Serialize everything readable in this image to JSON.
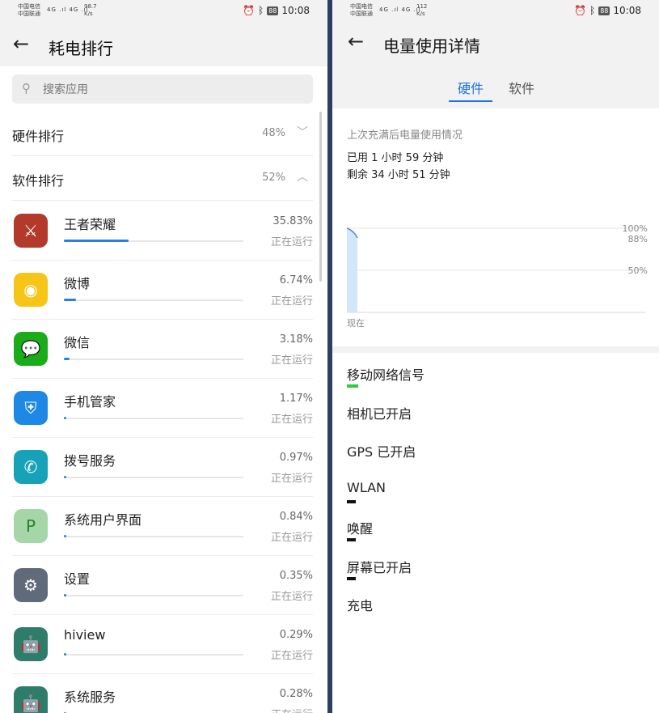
{
  "left": {
    "status": {
      "carrier1": "中国电信",
      "carrier2": "中国联通",
      "signal": "4G .ıl 4G .ıl",
      "speed_value": "98.7",
      "speed_unit": "K/s",
      "battery": "88",
      "time": "10:08"
    },
    "title": "耗电排行",
    "search_placeholder": "搜索应用",
    "sections": [
      {
        "label": "硬件排行",
        "pct": "48%"
      },
      {
        "label": "软件排行",
        "pct": "52%"
      }
    ],
    "apps": [
      {
        "name": "王者荣耀",
        "pct": "35.83%",
        "status": "正在运行",
        "fraction": 0.36,
        "icon": "game-icon",
        "color": "#b33a2a"
      },
      {
        "name": "微博",
        "pct": "6.74%",
        "status": "正在运行",
        "fraction": 0.0674,
        "icon": "weibo-icon",
        "color": "#f5c518"
      },
      {
        "name": "微信",
        "pct": "3.18%",
        "status": "正在运行",
        "fraction": 0.0318,
        "icon": "wechat-icon",
        "color": "#1aad19"
      },
      {
        "name": "手机管家",
        "pct": "1.17%",
        "status": "正在运行",
        "fraction": 0.0117,
        "icon": "shield-icon",
        "color": "#1e88e5"
      },
      {
        "name": "拨号服务",
        "pct": "0.97%",
        "status": "正在运行",
        "fraction": 0.0097,
        "icon": "phone-icon",
        "color": "#17a2b8"
      },
      {
        "name": "系统用户界面",
        "pct": "0.84%",
        "status": "正在运行",
        "fraction": 0.0084,
        "icon": "android-p-icon",
        "color": "#a5d6a7"
      },
      {
        "name": "设置",
        "pct": "0.35%",
        "status": "正在运行",
        "fraction": 0.0035,
        "icon": "settings-icon",
        "color": "#5f6b7a"
      },
      {
        "name": "hiview",
        "pct": "0.29%",
        "status": "正在运行",
        "fraction": 0.0029,
        "icon": "android-icon",
        "color": "#2e7d6b"
      },
      {
        "name": "系统服务",
        "pct": "0.28%",
        "status": "正在运行",
        "fraction": 0.0028,
        "icon": "android-icon",
        "color": "#2e7d6b"
      }
    ]
  },
  "right": {
    "status": {
      "carrier1": "中国电信",
      "carrier2": "中国联通",
      "signal": "4G .ıl 4G .ıl",
      "speed_value": "112",
      "speed_unit": "K/s",
      "battery": "88",
      "time": "10:08"
    },
    "title": "电量使用详情",
    "tabs": [
      "硬件",
      "软件"
    ],
    "usage_header": "上次充满后电量使用情况",
    "used": "已用 1 小时 59 分钟",
    "remaining": "剩余 34 小时 51 分钟",
    "chart": {
      "labels": [
        "100%",
        "88%",
        "50%"
      ],
      "xlabel": "现在",
      "battery_level": 88
    },
    "hardware": [
      {
        "label": "移动网络信号",
        "color": "#2ecc40"
      },
      {
        "label": "相机已开启"
      },
      {
        "label": "GPS 已开启"
      },
      {
        "label": "WLAN",
        "color": "#111"
      },
      {
        "label": "唤醒",
        "color": "#111"
      },
      {
        "label": "屏幕已开启",
        "color": "#111"
      },
      {
        "label": "充电"
      }
    ]
  }
}
